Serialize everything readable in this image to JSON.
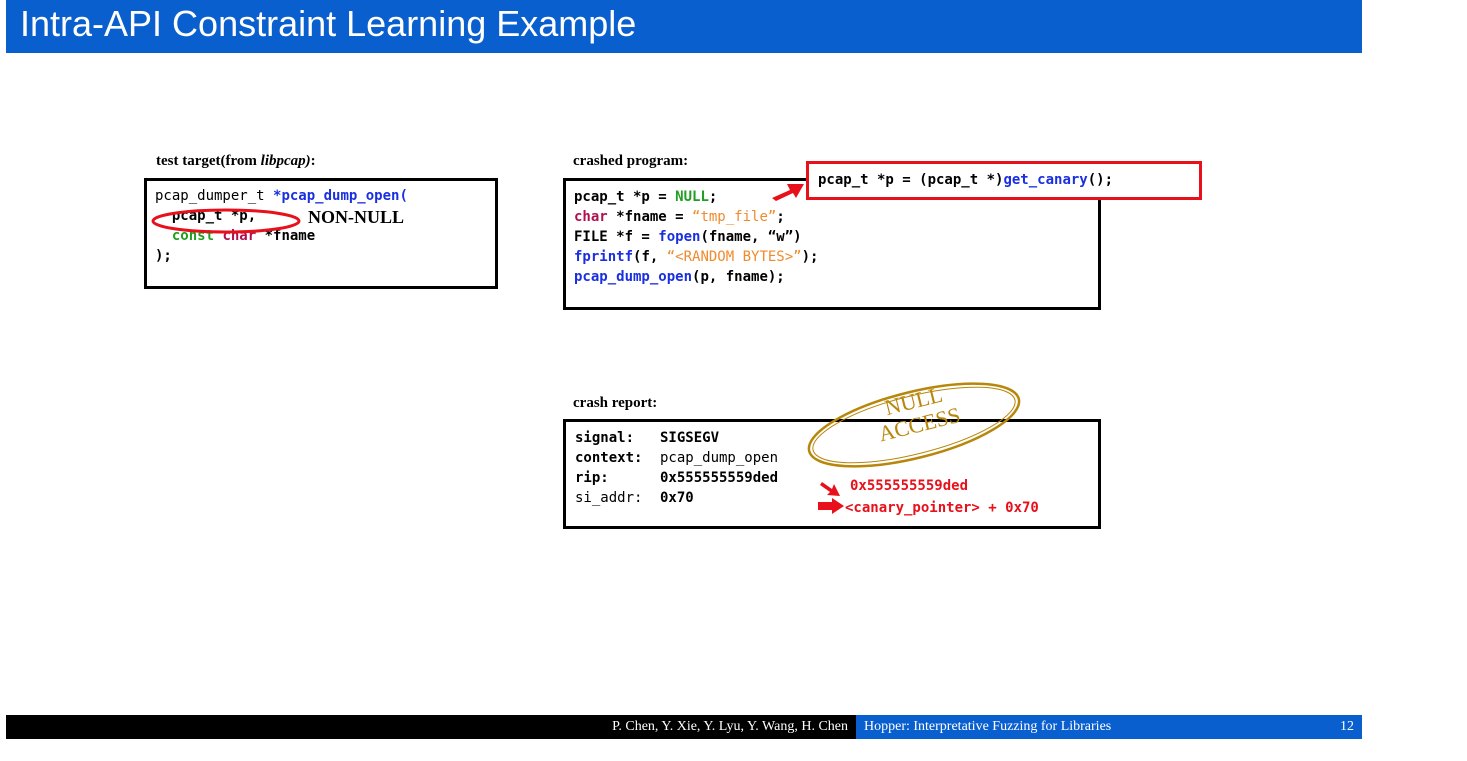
{
  "title": "Intra-API Constraint Learning Example",
  "left_panel": {
    "label_prefix": "test target(from ",
    "label_lib": "libpcap)",
    "label_suffix": ":",
    "line1_a": "pcap_dumper_t ",
    "line1_b": "*pcap_dump_open(",
    "line2": "pcap_t *p,",
    "line3_a": "const ",
    "line3_b": "char ",
    "line3_c": "*fname",
    "line4": ");",
    "annotation": "NON-NULL"
  },
  "crashed_program": {
    "label": "crashed program:",
    "l1_a": "pcap_t *p = ",
    "l1_b": "NULL",
    "l1_c": ";",
    "l2_a": "char ",
    "l2_b": "*fname = ",
    "l2_c": "“tmp_file”",
    "l2_d": ";",
    "l3_a": "FILE *f = ",
    "l3_b": "fopen",
    "l3_c": "(fname, “w”)",
    "l4_a": "fprintf",
    "l4_b": "(f, ",
    "l4_c": "“<RANDOM BYTES>”",
    "l4_d": ");",
    "l5_a": "pcap_dump_open",
    "l5_b": "(p, fname);",
    "replacement_a": "pcap_t *p = (pcap_t *)",
    "replacement_b": "get_canary",
    "replacement_c": "();"
  },
  "crash_report": {
    "label": "crash report:",
    "rows": [
      {
        "key": "signal:",
        "value": "SIGSEGV"
      },
      {
        "key": "context:",
        "value": "pcap_dump_open"
      },
      {
        "key": "rip:",
        "value": "0x555555559ded"
      },
      {
        "key": "si_addr:",
        "value": "0x70"
      }
    ],
    "stamp_line1": "NULL",
    "stamp_line2": "ACCESS",
    "annot_rip": "0x555555559ded",
    "annot_addr": "<canary_pointer> + 0x70"
  },
  "footer": {
    "authors": "P. Chen, Y. Xie, Y. Lyu, Y. Wang, H. Chen",
    "talk": "Hopper: Interpretative Fuzzing for Libraries",
    "page": "12"
  },
  "colors": {
    "title_bar": "#0a5fcf",
    "keyword_blue": "#1a2fe0",
    "keyword_green": "#1f9e1f",
    "keyword_maroon": "#b0104f",
    "string_orange": "#f08a2c",
    "highlight_red": "#e8101a",
    "stamp_gold": "#b8860b"
  }
}
